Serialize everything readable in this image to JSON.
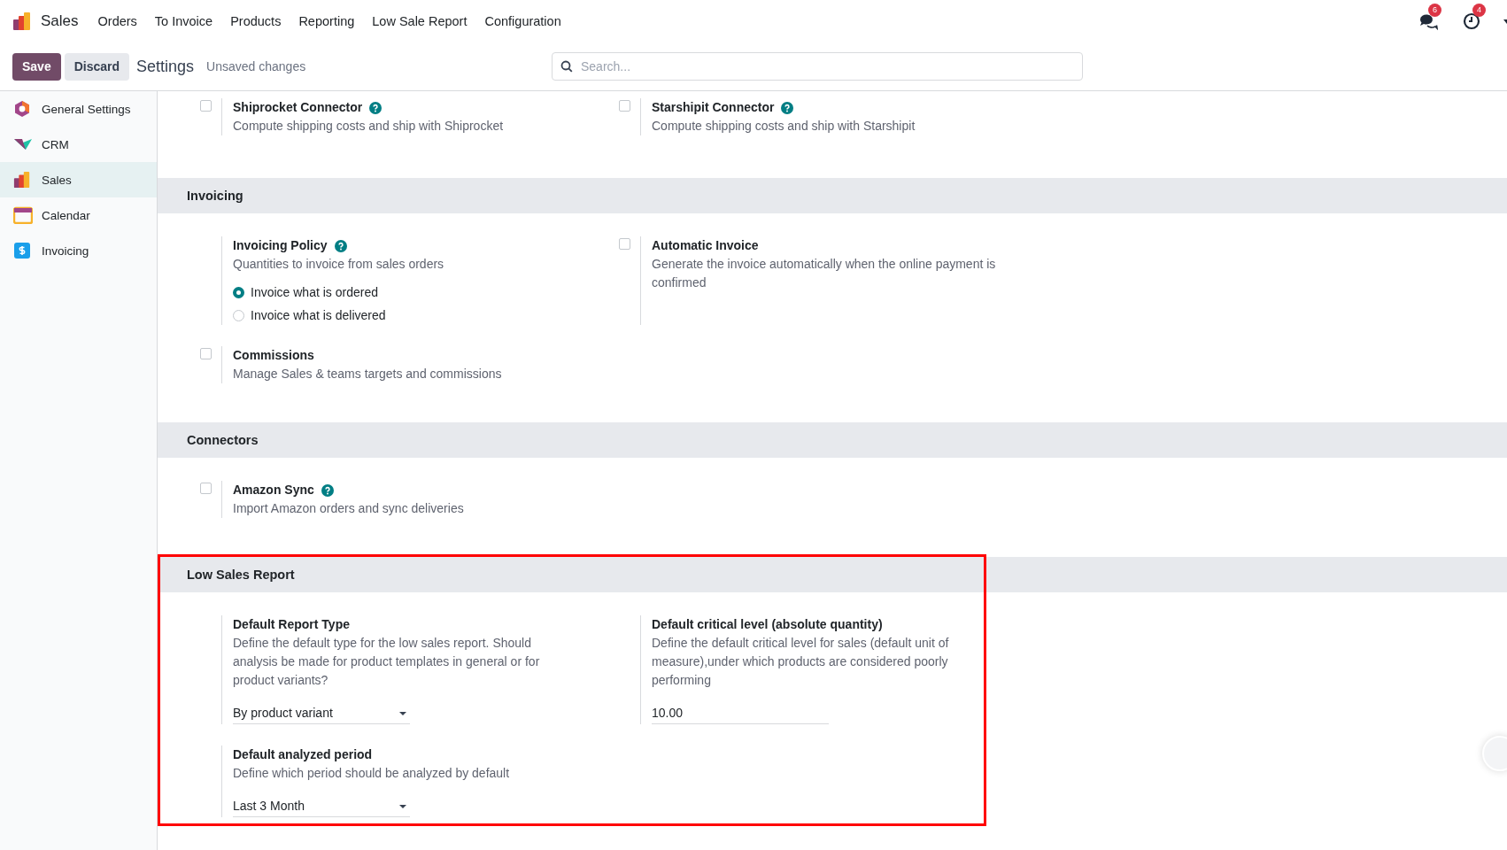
{
  "app": {
    "name": "Sales"
  },
  "menu": [
    "Orders",
    "To Invoice",
    "Products",
    "Reporting",
    "Low Sale Report",
    "Configuration"
  ],
  "notifications": [
    {
      "kind": "messages",
      "count": "6"
    },
    {
      "kind": "activities",
      "count": "4"
    }
  ],
  "control_bar": {
    "save": "Save",
    "discard": "Discard",
    "title": "Settings",
    "status": "Unsaved changes"
  },
  "search": {
    "placeholder": "Search..."
  },
  "sidebar": {
    "items": [
      {
        "kind": "general",
        "label": "General Settings",
        "selected": false
      },
      {
        "kind": "crm",
        "label": "CRM",
        "selected": false
      },
      {
        "kind": "sales",
        "label": "Sales",
        "selected": true
      },
      {
        "kind": "calendar",
        "label": "Calendar",
        "selected": false
      },
      {
        "kind": "invoicing",
        "label": "Invoicing",
        "selected": false
      }
    ]
  },
  "sections": [
    {
      "highlighted": false,
      "settings": [
        {
          "title": "Shiprocket Connector",
          "help": true,
          "checked": false,
          "description": "Compute shipping costs and ship with Shiprocket"
        },
        {
          "title": "Starshipit Connector",
          "help": true,
          "checked": false,
          "description": "Compute shipping costs and ship with Starshipit"
        }
      ]
    },
    {
      "title": "Invoicing",
      "highlighted": false,
      "settings": [
        {
          "title": "Invoicing Policy",
          "help": true,
          "description": "Quantities to invoice from sales orders",
          "control": {
            "kind": "radio",
            "options": [
              {
                "label": "Invoice what is ordered",
                "selected": true
              },
              {
                "label": "Invoice what is delivered",
                "selected": false
              }
            ]
          }
        },
        {
          "title": "Automatic Invoice",
          "help": false,
          "checked": false,
          "description": "Generate the invoice automatically when the online payment is confirmed"
        },
        {
          "title": "Commissions",
          "help": false,
          "checked": false,
          "description": "Manage Sales & teams targets and commissions"
        }
      ]
    },
    {
      "title": "Connectors",
      "highlighted": false,
      "settings": [
        {
          "title": "Amazon Sync",
          "help": true,
          "checked": false,
          "description": "Import Amazon orders and sync deliveries"
        }
      ]
    },
    {
      "title": "Low Sales Report",
      "highlighted": true,
      "settings": [
        {
          "title": "Default Report Type",
          "help": false,
          "description": "Define the default type for the low sales report. Should analysis be made for product templates in general or for product variants?",
          "control": {
            "kind": "select",
            "value": "By product variant"
          }
        },
        {
          "title": "Default critical level (absolute quantity)",
          "help": false,
          "description": "Define the default critical level for sales (default unit of measure),under which products are considered poorly performing",
          "control": {
            "kind": "input",
            "value": "10.00"
          }
        },
        {
          "title": "Default analyzed period",
          "help": false,
          "description": "Define which period should be analyzed by default",
          "control": {
            "kind": "select",
            "value": "Last 3 Month"
          }
        }
      ]
    }
  ]
}
